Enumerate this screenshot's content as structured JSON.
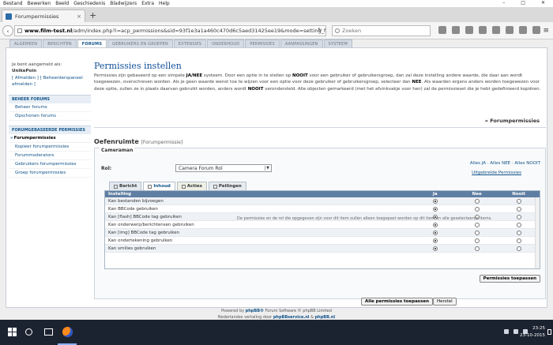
{
  "menu": [
    "Bestand",
    "Bewerken",
    "Beeld",
    "Geschiedenis",
    "Bladwijzers",
    "Extra",
    "Help"
  ],
  "window_controls": [
    "–",
    "□",
    "✕"
  ],
  "browser_tab": {
    "title": "Forumpermissies",
    "close": "×",
    "new_tab": "+"
  },
  "url": {
    "host": "www.film-test.nl",
    "path": "/adm/index.php?i=acp_permissions&sid=93f1e3a1a460c470d6c5aed31425ee19&mode=setting_forum"
  },
  "search": {
    "placeholder": "Zoeken"
  },
  "acp_tabs": [
    "ALGEMEEN",
    "BERICHTEN",
    "FORUMS",
    "GEBRUIKERS EN GROEPEN",
    "EXTENSIES",
    "ONDERHOUD",
    "PERMISSIES",
    "AANPASSINGEN",
    "SYSTEEM"
  ],
  "acp_active_tab": "FORUMS",
  "sidebar": {
    "login_text": "Je bent aangemeld als:",
    "username": "UnikePoin",
    "logout": "[ Afmelden ]",
    "admin_panel": "[ Beheerderspaneel afmelden ]",
    "sections": [
      {
        "title": "BEHEER FORUMS",
        "items": [
          "Beheer forums",
          "Opschonen forums"
        ]
      },
      {
        "title": "FORUMGEBASEERDE PERMISSIES",
        "items": [
          "Forumpermissies",
          "Kopieer forumpermissies",
          "Forummoderators",
          "Gebruikers forumpermissies",
          "Groep forumpermissies"
        ]
      }
    ],
    "active_item": "Forumpermissies"
  },
  "main": {
    "title": "Permissies instellen",
    "intro_1": "Permissies zijn gebaseerd op een simpele ",
    "intro_b1": "JA/NEE",
    "intro_2": " systeem. Door een optie in te stellen op ",
    "intro_b2": "NOOIT",
    "intro_3": " voor een gebruiker of gebruikersgroep, dan zal deze instelling andere waarde, die daar aan wordt toegewezen, overschreven worden. Als je geen waarde wenst toe te wijzen voor een optie voor deze gebruiker of gebruikersgroep, selecteer dan ",
    "intro_b3": "NEE",
    "intro_4": ". Als waarden ergens anders worden toegewezen voor deze optie, zullen ze in plaats daarvan gebruikt worden, anders wordt ",
    "intro_b4": "NOOIT",
    "intro_5": " verondersteld. Alle objecten gemarkeerd (met het afvinkvakje voor hen) zal de permissieset die je hebt gedefinieerd kopiëren.",
    "crumb": "» Forumpermissies",
    "section_title": "Oefenruimte",
    "section_sub": "[Forumpermissie]",
    "fieldset_legend": "Cameraman",
    "role_label": "Rol:",
    "role_value": "Camera Forum Rol",
    "all_yes": "Alles JA",
    "all_no": "Alles NEE",
    "all_never": "Alles NOOIT",
    "advanced": "Uitgebreide Permissies",
    "tabs": [
      "Bericht",
      "Inhoud",
      "Acties",
      "Peilingen"
    ],
    "active_tab": "Inhoud",
    "table_head": [
      "Instelling",
      "Ja",
      "Nee",
      "Nooit"
    ],
    "rows": [
      {
        "label": "Kan bestanden bijvoegen",
        "value": "Ja"
      },
      {
        "label": "Kan BBCode gebruiken",
        "value": "Ja"
      },
      {
        "label": "Kan [flash] BBCode tag gebruiken",
        "value": "Ja"
      },
      {
        "label": "Kan onderwerp/berichtensen gebruiken",
        "value": "Ja"
      },
      {
        "label": "Kan [img] BBCode tag gebruiken",
        "value": "Ja"
      },
      {
        "label": "Kan ondertekening gebruiken",
        "value": "Ja"
      },
      {
        "label": "Kan smilies gebruiken",
        "value": "Ja"
      }
    ],
    "note": "De permissies en de rol die opgegeven zijn voor dit item zullen alleen toegepast worden op dit item en alle geselecteerde items.",
    "apply_button": "Permissies toepassen",
    "apply_all_button": "Alle permissies toepassen",
    "reset_button": "Herstel"
  },
  "footer": {
    "line1_a": "Powered by ",
    "line1_b": "phpBB®",
    "line1_c": " Forum Software © phpBB Limited",
    "line2_a": "Nederlandse vertaling door ",
    "line2_b": "phpBBservice.nl",
    "line2_c": " & ",
    "line2_d": "phpBB.nl"
  },
  "taskbar": {
    "time": "23:25",
    "date": "23-10-2015"
  }
}
